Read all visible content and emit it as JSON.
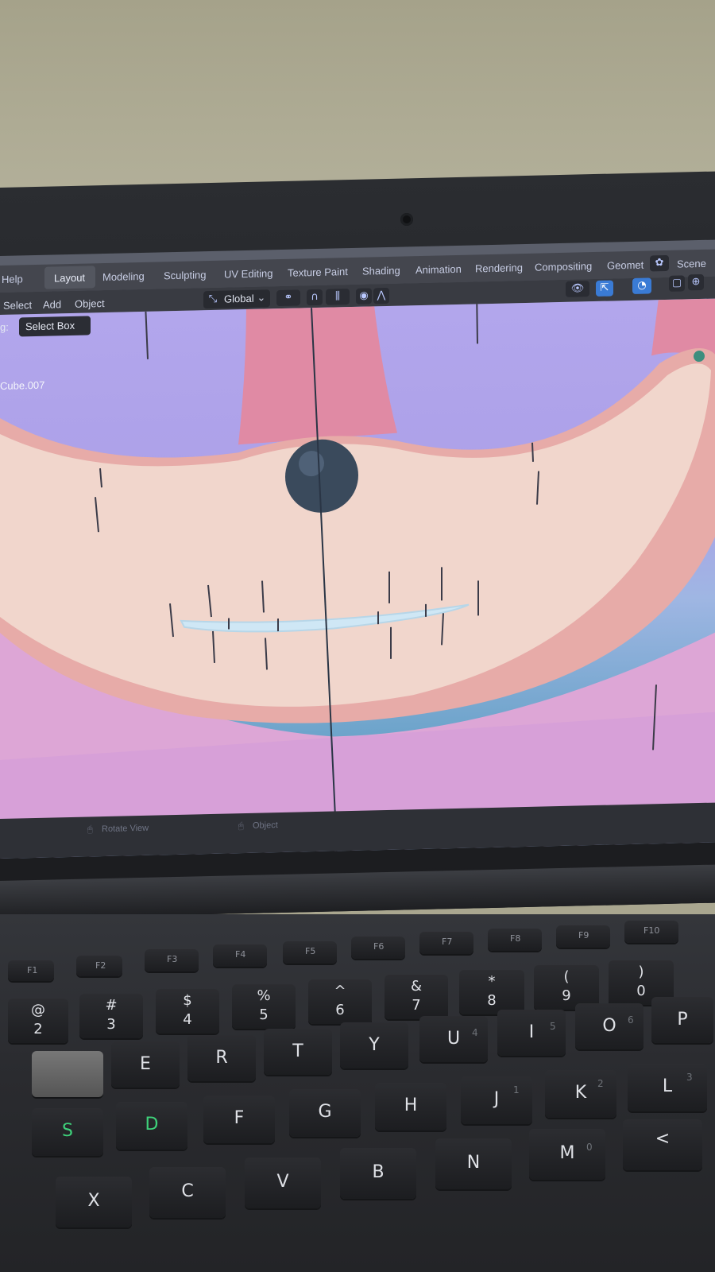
{
  "blender": {
    "menu": {
      "help": "Help",
      "tabs": [
        "Layout",
        "Modeling",
        "Sculpting",
        "UV Editing",
        "Texture Paint",
        "Shading",
        "Animation",
        "Rendering",
        "Compositing",
        "Geomet"
      ],
      "scene": "Scene"
    },
    "toolbar": {
      "select": "Select",
      "add": "Add",
      "object": "Object",
      "transform_orientation": "Global"
    },
    "tool_settings": {
      "drag_label": "g:",
      "select_box": "Select Box"
    },
    "viewport": {
      "object_name": "Cube.007"
    },
    "status_bar": {
      "rotate_view": "Rotate View",
      "object": "Object"
    }
  },
  "keyboard": {
    "fn_row": [
      "F1",
      "F2",
      "F3",
      "F4",
      "F5",
      "F6",
      "F7",
      "F8",
      "F9",
      "F10"
    ],
    "number_row": [
      {
        "top": "@",
        "bottom": "2"
      },
      {
        "top": "#",
        "bottom": "3"
      },
      {
        "top": "$",
        "bottom": "4"
      },
      {
        "top": "%",
        "bottom": "5"
      },
      {
        "top": "^",
        "bottom": "6"
      },
      {
        "top": "&",
        "bottom": "7"
      },
      {
        "top": "*",
        "bottom": "8"
      },
      {
        "top": "(",
        "bottom": "9"
      },
      {
        "top": ")",
        "bottom": "0"
      }
    ],
    "top_letters": [
      "E",
      "R",
      "T",
      "Y",
      "U",
      "I",
      "O",
      "P"
    ],
    "home_letters": [
      "S",
      "D",
      "F",
      "G",
      "H",
      "J",
      "K",
      "L"
    ],
    "bottom_letters": [
      "X",
      "C",
      "V",
      "B",
      "N",
      "M"
    ],
    "numpad_hints": {
      "U": "4",
      "I": "5",
      "O": "6",
      "J": "1",
      "K": "2",
      "L": "3",
      "M": "0"
    }
  }
}
